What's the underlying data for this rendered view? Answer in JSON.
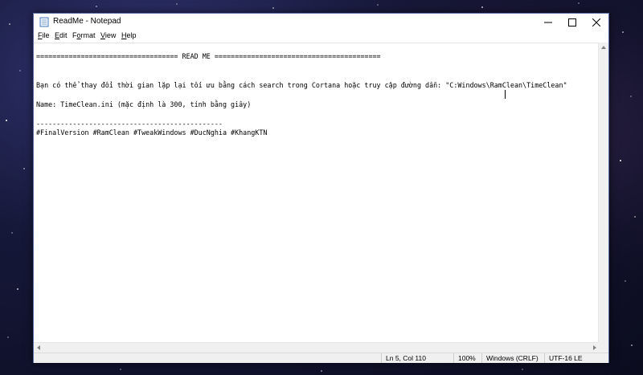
{
  "window": {
    "title": "ReadMe - Notepad"
  },
  "menu": {
    "items": [
      {
        "access_key": "F",
        "rest": "ile"
      },
      {
        "access_key": "E",
        "rest": "dit"
      },
      {
        "access_key": "o",
        "prefix": "F",
        "rest": "rmat"
      },
      {
        "access_key": "V",
        "rest": "iew"
      },
      {
        "access_key": "H",
        "rest": "elp"
      }
    ]
  },
  "document": {
    "lines": [
      "=================================== READ ME =========================================",
      "",
      "Bạn có thể thay đổi thời gian lặp lại tối ưu bằng cách search trong Cortana hoặc truy cập đường dẫn: \"C:Windows\\RamClean\\TimeClean\"",
      "",
      "Name: TimeClean.ini (mặc định là 300, tính bằng giây)",
      "",
      "----------------------------------------------",
      "#FinalVersion #RamClean #TweakWindows #DucNghia #KhangKTN"
    ]
  },
  "status": {
    "position": "Ln 5, Col 110",
    "zoom": "100%",
    "line_ending": "Windows (CRLF)",
    "encoding": "UTF-16 LE"
  },
  "icons": {
    "app": "notepad-icon",
    "minimize": "minimize-icon",
    "maximize": "maximize-icon",
    "close": "close-icon"
  }
}
